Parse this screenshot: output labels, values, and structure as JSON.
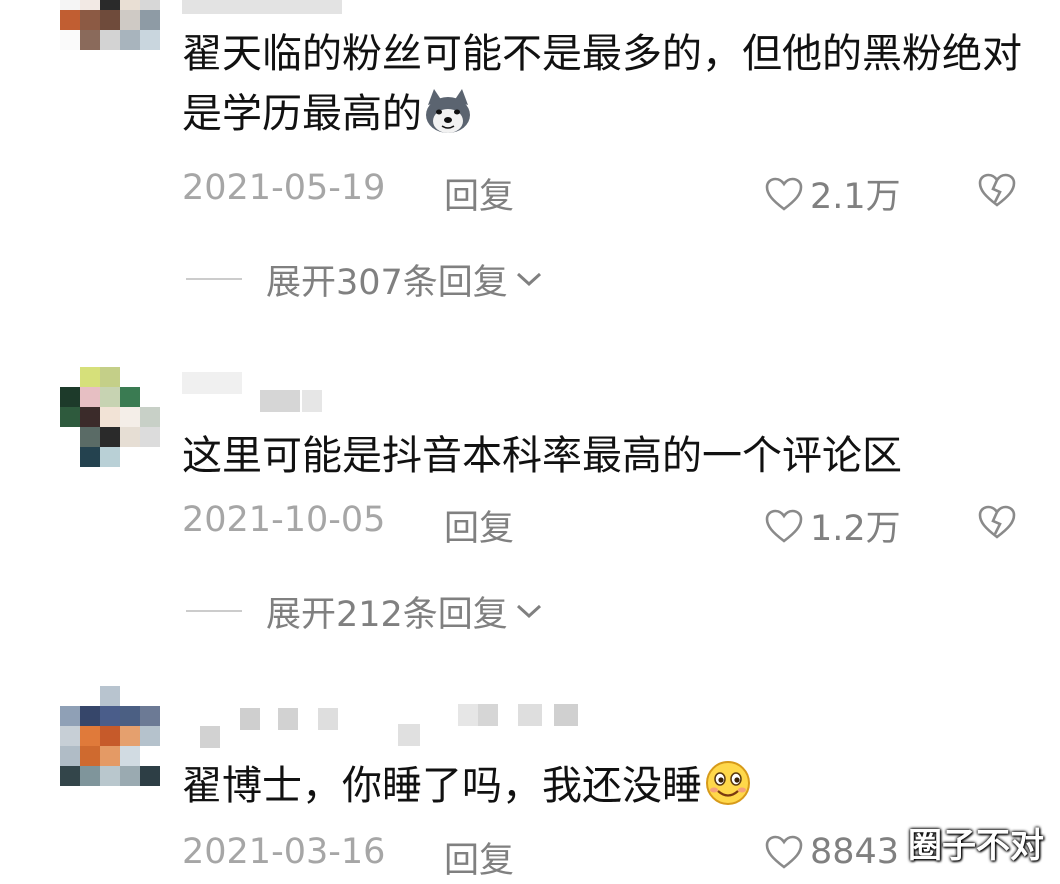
{
  "comments": [
    {
      "text": "翟天临的粉丝可能不是最多的，但他的黑粉绝对是学历最高的",
      "emoji": "husky-doge-emoji",
      "date": "2021-05-19",
      "reply_label": "回复",
      "likes": "2.1万",
      "expand_label": "展开307条回复"
    },
    {
      "text": "这里可能是抖音本科率最高的一个评论区",
      "date": "2021-10-05",
      "reply_label": "回复",
      "likes": "1.2万",
      "expand_label": "展开212条回复"
    },
    {
      "text": "翟博士，你睡了吗，我还没睡",
      "emoji": "smile-emoji",
      "date": "2021-03-16",
      "reply_label": "回复",
      "likes": "8843"
    }
  ],
  "watermark": "圈子不对",
  "colors": {
    "text": "#111111",
    "meta_gray": "#a6a6a6",
    "action_gray": "#808080"
  },
  "icons": [
    "heart-outline-icon",
    "broken-heart-icon",
    "chevron-down-icon"
  ]
}
